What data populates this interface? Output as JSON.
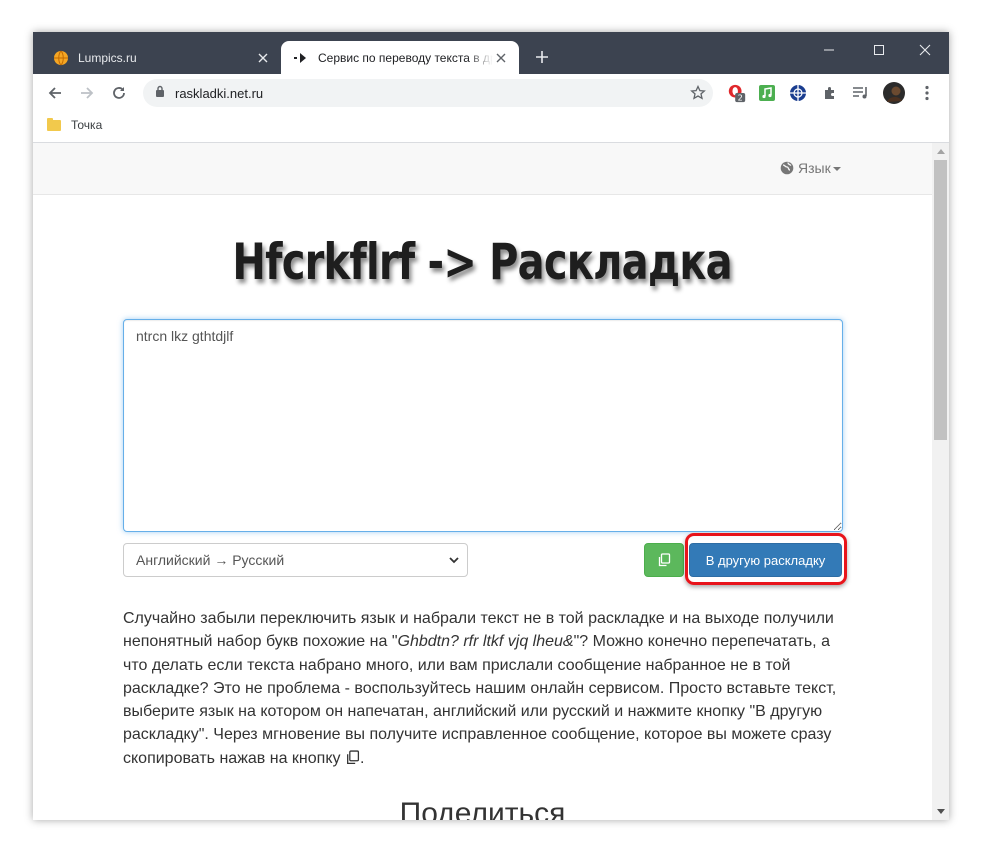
{
  "tabs": [
    {
      "title": "Lumpics.ru",
      "active": false,
      "favicon": "orange-globe-icon"
    },
    {
      "title": "Сервис по переводу текста в другую раскладку",
      "active": true,
      "favicon": "arrow-right-icon"
    }
  ],
  "toolbar": {
    "url": "raskladki.net.ru",
    "extension_badge": "2"
  },
  "bookmarks": [
    {
      "label": "Точка",
      "icon": "folder-icon"
    }
  ],
  "site": {
    "language_menu": "Язык",
    "logo_text": "Hfcrkflrf -> Раскладка",
    "input_text": "ntrcn lkz gthtdjlf",
    "direction_select": "Английский → Русский",
    "convert_button": "В другую раскладку",
    "description": {
      "part1": "Случайно забыли переключить язык и набрали текст не в той раскладке и на выходе получили непонятный набор букв похожие на \"",
      "example": "Ghbdtn? rfr ltkf vjq lheu&",
      "part2": "\"? Можно конечно перепечатать, а что делать если текста набрано много, или вам прислали сообщение набранное не в той раскладке? Это не проблема - воспользуйтесь нашим онлайн сервисом. Просто вставьте текст, выберите язык на котором он напечатан, английский или русский и нажмите кнопку \"В другую раскладку\". Через мгновение вы получите исправленное сообщение, которое вы можете сразу скопировать нажав на кнопку ",
      "part3": "."
    },
    "share_heading": "Поделиться"
  },
  "colors": {
    "tabstrip": "#3c4350",
    "convert_button": "#337ab7",
    "copy_button": "#5cb85c",
    "highlight": "#e8141b"
  }
}
